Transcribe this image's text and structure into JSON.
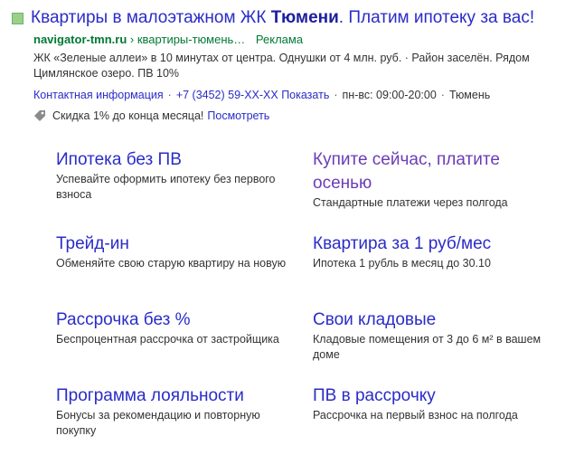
{
  "ad": {
    "title_prefix": "Квартиры в малоэтажном ЖК ",
    "title_bold": "Тюмени",
    "title_suffix": ". Платим ипотеку за вас!",
    "domain": "navigator-tmn.ru",
    "path": "› квартиры-тюмень…",
    "ad_label": "Реклама",
    "description": "ЖК «Зеленые аллеи» в 10 минутах от центра. Однушки от 4 млн. руб. · Район заселён. Рядом Цимлянское озеро. ПВ 10%",
    "contact_label": "Контактная информация",
    "phone": "+7 (3452) 59-XX-XX Показать",
    "hours": "пн-вс: 09:00-20:00",
    "city": "Тюмень",
    "promo_text": "Скидка 1% до конца месяца!",
    "promo_link": "Посмотреть"
  },
  "sitelinks": [
    {
      "title": "Ипотека без ПВ",
      "desc": "Успевайте оформить ипотеку без первого взноса"
    },
    {
      "title": "Купите сейчас, платите осенью",
      "desc": "Стандартные платежи через полгода"
    },
    {
      "title": "Трейд-ин",
      "desc": "Обменяйте свою старую квартиру на новую"
    },
    {
      "title": "Квартира за 1 руб/мес",
      "desc": "Ипотека 1 рубль в месяц до 30.10"
    },
    {
      "title": "Рассрочка без %",
      "desc": "Беспроцентная рассрочка от застройщика"
    },
    {
      "title": "Свои кладовые",
      "desc": "Кладовые помещения от 3 до 6 м² в вашем доме"
    },
    {
      "title": "Программа лояльности",
      "desc": "Бонусы за рекомендацию и повторную покупку"
    },
    {
      "title": "ПВ в рассрочку",
      "desc": "Рассрочка на первый взнос на полгода"
    }
  ],
  "colors": {
    "link": "#2a2cc8",
    "visited": "#6a3db5",
    "url_green": "#007a33"
  }
}
